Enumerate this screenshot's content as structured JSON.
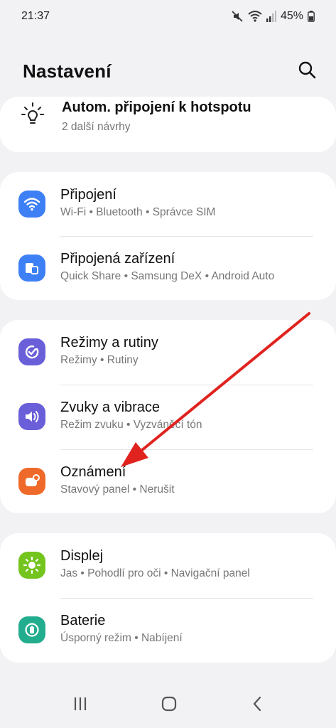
{
  "status": {
    "time": "21:37",
    "battery": "45%"
  },
  "header": {
    "title": "Nastavení"
  },
  "suggestion": {
    "title": "Autom. připojení k hotspotu",
    "subtitle": "2 další návrhy"
  },
  "groups": [
    {
      "items": [
        {
          "label": "Připojení",
          "sub": "Wi-Fi  •  Bluetooth  •  Správce SIM",
          "icon": "wifi-icon",
          "color": "#3d80f5"
        },
        {
          "label": "Připojená zařízení",
          "sub": "Quick Share  •  Samsung DeX  •  Android Auto",
          "icon": "devices-icon",
          "color": "#3d80f5"
        }
      ]
    },
    {
      "items": [
        {
          "label": "Režimy a rutiny",
          "sub": "Režimy  •  Rutiny",
          "icon": "modes-check-icon",
          "color": "#6a5fd8"
        },
        {
          "label": "Zvuky a vibrace",
          "sub": "Režim zvuku  •  Vyzváněcí tón",
          "icon": "volume-icon",
          "color": "#6a5fd8"
        },
        {
          "label": "Oznámení",
          "sub": "Stavový panel  •  Nerušit",
          "icon": "notification-icon",
          "color": "#ef6a2a"
        }
      ]
    },
    {
      "items": [
        {
          "label": "Displej",
          "sub": "Jas  •  Pohodlí pro oči  •  Navigační panel",
          "icon": "sun-icon",
          "color": "#74c41e"
        },
        {
          "label": "Baterie",
          "sub": "Úsporný režim  •  Nabíjení",
          "icon": "battery-icon",
          "color": "#23ad8f"
        }
      ]
    }
  ],
  "annotation": {
    "arrow_color": "#e0231f"
  }
}
